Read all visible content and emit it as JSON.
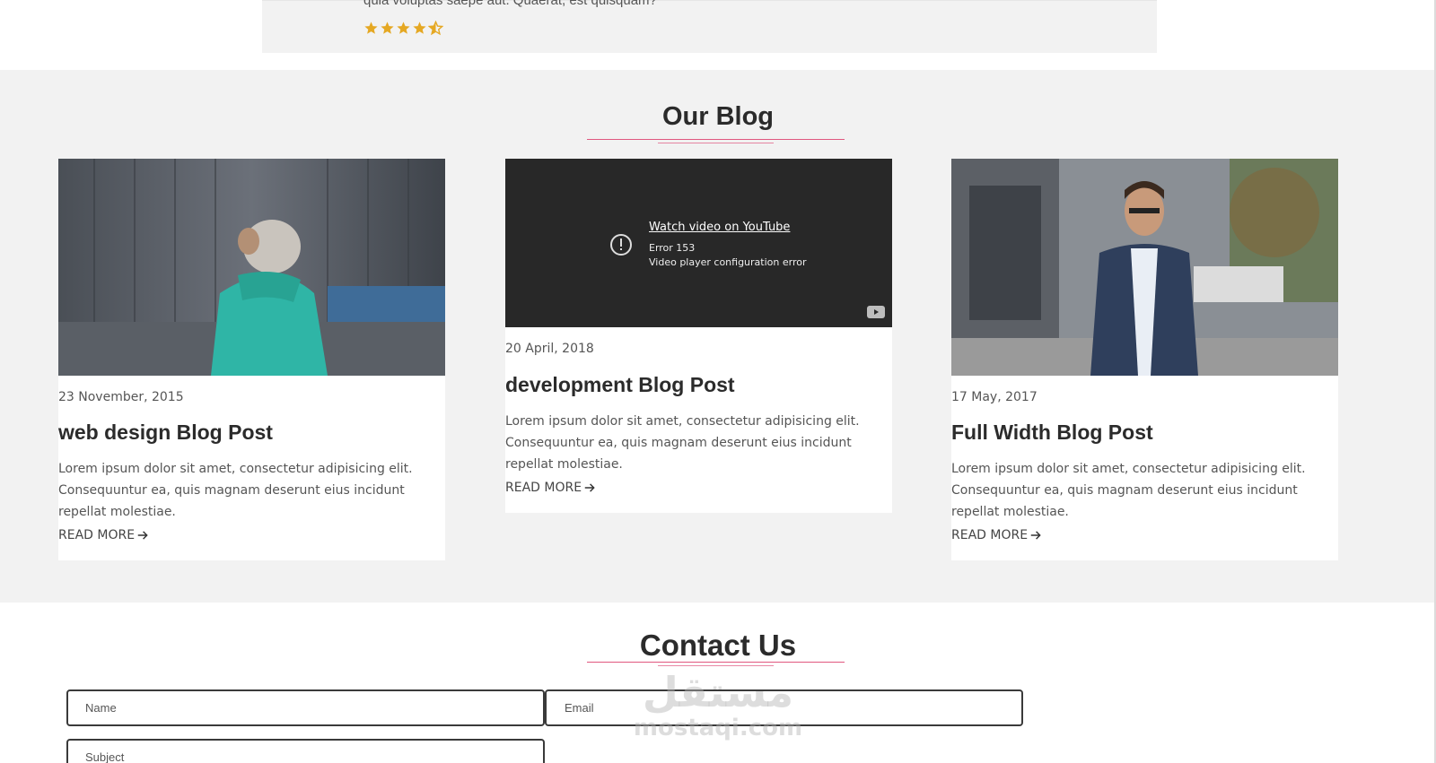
{
  "testimonial": {
    "text": "quia voluptas saepe aut. Quaerat, est quisquam?",
    "rating": 4.5,
    "star_color": "#e5a823"
  },
  "blog": {
    "title": "Our Blog",
    "accent_color": "#e0577f",
    "posts": [
      {
        "date": "23 November, 2015",
        "title": "web design Blog Post",
        "body": "Lorem ipsum dolor sit amet, consectetur adipisicing elit. Consequuntur ea, quis magnam deserunt eius incidunt repellat molestiae.",
        "link": "READ MORE",
        "media": "photo-woman-teal-jacket"
      },
      {
        "date": "20 April, 2018",
        "title": "development Blog Post",
        "body": "Lorem ipsum dolor sit amet, consectetur adipisicing elit. Consequuntur ea, quis magnam deserunt eius incidunt repellat molestiae.",
        "link": "READ MORE",
        "media": "youtube-embed",
        "video": {
          "link_text": "Watch video on YouTube",
          "error_code": "Error 153",
          "error_message": "Video player configuration error"
        }
      },
      {
        "date": "17 May, 2017",
        "title": "Full Width Blog Post",
        "body": "Lorem ipsum dolor sit amet, consectetur adipisicing elit. Consequuntur ea, quis magnam deserunt eius incidunt repellat molestiae.",
        "link": "READ MORE ",
        "media": "photo-man-waistcoat"
      }
    ]
  },
  "contact": {
    "title": "Contact Us",
    "fields": {
      "name_placeholder": "Name",
      "email_placeholder": "Email",
      "subject_placeholder": "Subject"
    }
  },
  "watermark": {
    "arabic": "مستقل",
    "latin": "mostaqi.com"
  }
}
